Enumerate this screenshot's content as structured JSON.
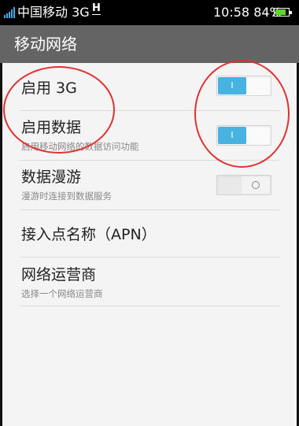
{
  "status_bar": {
    "carrier": "中国移动 3G",
    "network_icon": "H",
    "time_battery": "10:58 84%",
    "battery_level": 0.84
  },
  "title": "移动网络",
  "settings": [
    {
      "title": "启用 3G",
      "subtitle": "",
      "toggle": "on",
      "toggle_label": "I"
    },
    {
      "title": "启用数据",
      "subtitle": "启用移动网络的数据访问功能",
      "toggle": "on",
      "toggle_label": "I"
    },
    {
      "title": "数据漫游",
      "subtitle": "漫游时连接到数据服务",
      "toggle": "off"
    },
    {
      "title": "接入点名称（APN）",
      "subtitle": ""
    },
    {
      "title": "网络运营商",
      "subtitle": "选择一个网络运营商"
    }
  ],
  "colors": {
    "title_bar": "#646464",
    "toggle_on": "#48b3e0",
    "annotation": "#e03030",
    "background": "#f4f4f4"
  }
}
